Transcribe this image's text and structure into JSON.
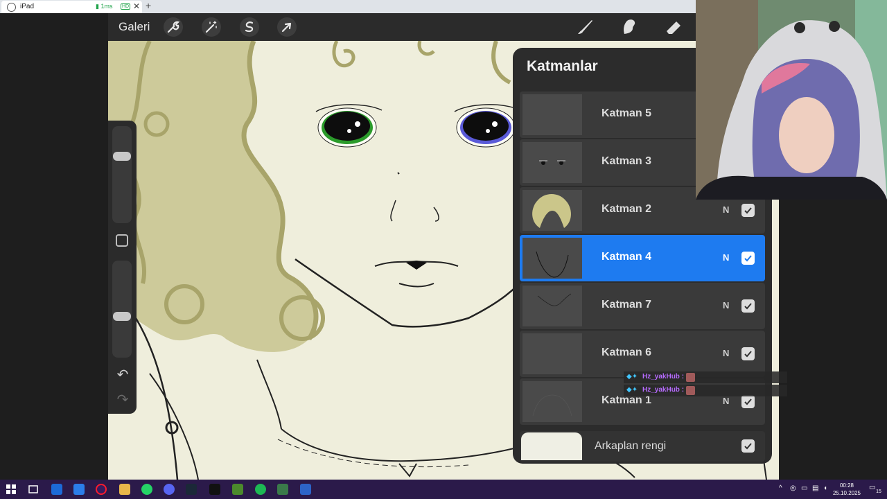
{
  "browser": {
    "tab_title": "iPad",
    "latency": "1ms",
    "quality_badge": "HD",
    "close_glyph": "✕",
    "new_tab_glyph": "+"
  },
  "procreate": {
    "gallery_label": "Galeri",
    "top_tools": [
      "wrench-icon",
      "magic-wand-icon",
      "selection-icon",
      "transform-arrow-icon"
    ],
    "right_tools": [
      "brush-icon",
      "smudge-icon",
      "eraser-icon"
    ]
  },
  "sidebar": {
    "brush_size_level": 0.82,
    "opacity_level": 0.4,
    "undo_glyph": "↶",
    "redo_glyph": "↷"
  },
  "layers_panel": {
    "title": "Katmanlar",
    "layers": [
      {
        "name": "Katman 5",
        "mode": "",
        "visible": true,
        "selected": false
      },
      {
        "name": "Katman 3",
        "mode": "",
        "visible": true,
        "selected": false
      },
      {
        "name": "Katman 2",
        "mode": "N",
        "visible": true,
        "selected": false
      },
      {
        "name": "Katman 4",
        "mode": "N",
        "visible": true,
        "selected": true
      },
      {
        "name": "Katman 7",
        "mode": "N",
        "visible": true,
        "selected": false
      },
      {
        "name": "Katman 6",
        "mode": "N",
        "visible": true,
        "selected": false
      },
      {
        "name": "Katman 1",
        "mode": "N",
        "visible": true,
        "selected": false
      }
    ],
    "background": {
      "name": "Arkaplan rengi",
      "color": "#efefe4",
      "visible": true
    }
  },
  "chat": [
    {
      "user": "Hz_yakHub",
      "sep": ":"
    },
    {
      "user": "Hz_yakHub",
      "sep": ":"
    }
  ],
  "taskbar": {
    "time": "00:28",
    "date": "25.10.2025",
    "notifications": "15",
    "accent": "#2b1a4a"
  }
}
